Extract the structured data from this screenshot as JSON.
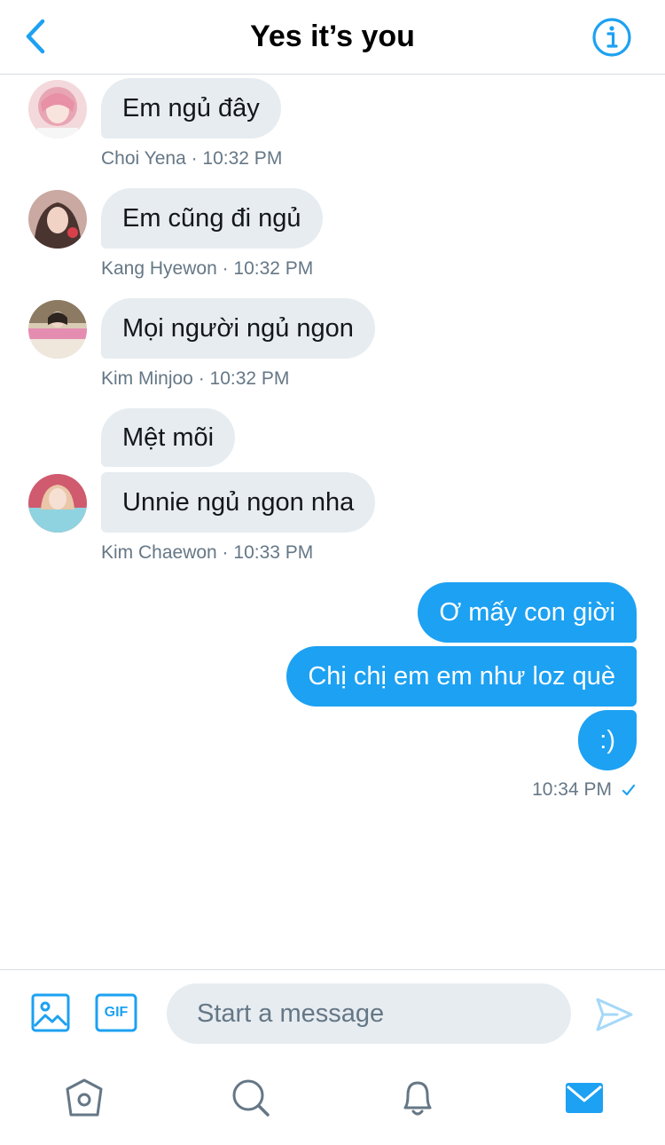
{
  "header": {
    "title": "Yes it’s you",
    "back_icon": "chevron-left-icon",
    "info_icon": "info-icon"
  },
  "messages": [
    {
      "sender": "Choi Yena",
      "time": "10:32 PM",
      "texts": [
        "Em ngủ đây"
      ],
      "meta": "Choi Yena · 10:32 PM"
    },
    {
      "sender": "Kang Hyewon",
      "time": "10:32 PM",
      "texts": [
        "Em cũng đi ngủ"
      ],
      "meta": "Kang Hyewon · 10:32 PM"
    },
    {
      "sender": "Kim Minjoo",
      "time": "10:32 PM",
      "texts": [
        "Mọi người ngủ ngon"
      ],
      "meta": "Kim Minjoo · 10:32 PM"
    },
    {
      "sender": "Kim Chaewon",
      "time": "10:33 PM",
      "texts": [
        "Mệt mõi",
        "Unnie ngủ ngon nha"
      ],
      "meta": "Kim Chaewon · 10:33 PM"
    }
  ],
  "outgoing": {
    "texts": [
      "Ơ mấy con giời",
      "Chị chị em em như loz què",
      ":)"
    ],
    "time": "10:34 PM",
    "status_icon": "check-icon"
  },
  "composer": {
    "placeholder": "Start a message",
    "media_icon": "image-icon",
    "gif_label": "GIF",
    "send_icon": "send-icon"
  },
  "tabs": [
    {
      "name": "home",
      "icon": "home-icon"
    },
    {
      "name": "search",
      "icon": "search-icon"
    },
    {
      "name": "notifications",
      "icon": "bell-icon"
    },
    {
      "name": "messages",
      "icon": "mail-icon",
      "active": true
    }
  ],
  "colors": {
    "accent": "#1da1f2",
    "incoming_bubble": "#e6ecf0",
    "meta_text": "#657786",
    "inactive_icon": "#657786"
  }
}
